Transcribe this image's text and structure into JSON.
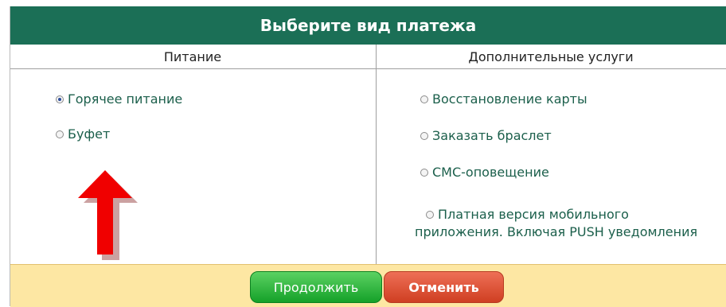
{
  "title": "Выберите вид платежа",
  "columns": {
    "left": "Питание",
    "right": "Дополнительные услуги"
  },
  "food_options": [
    {
      "label": "Горячее питание",
      "selected": true
    },
    {
      "label": "Буфет",
      "selected": false
    }
  ],
  "extra_options": [
    {
      "label": "Восстановление карты",
      "selected": false
    },
    {
      "label": "Заказать браслет",
      "selected": false
    },
    {
      "label": "СМС-оповещение",
      "selected": false
    },
    {
      "label_line1": "Платная версия мобильного",
      "label_line2": "приложения. Включая PUSH уведомления",
      "selected": false
    }
  ],
  "buttons": {
    "continue": "Продолжить",
    "cancel": "Отменить"
  },
  "colors": {
    "header": "#1b6f56",
    "footer": "#fde7a3",
    "continue": "#15a129",
    "cancel": "#cf3f22",
    "text": "#1b5f4b",
    "arrow": "#e00000"
  },
  "icons": {
    "pointer": "red-arrow-up-icon"
  }
}
